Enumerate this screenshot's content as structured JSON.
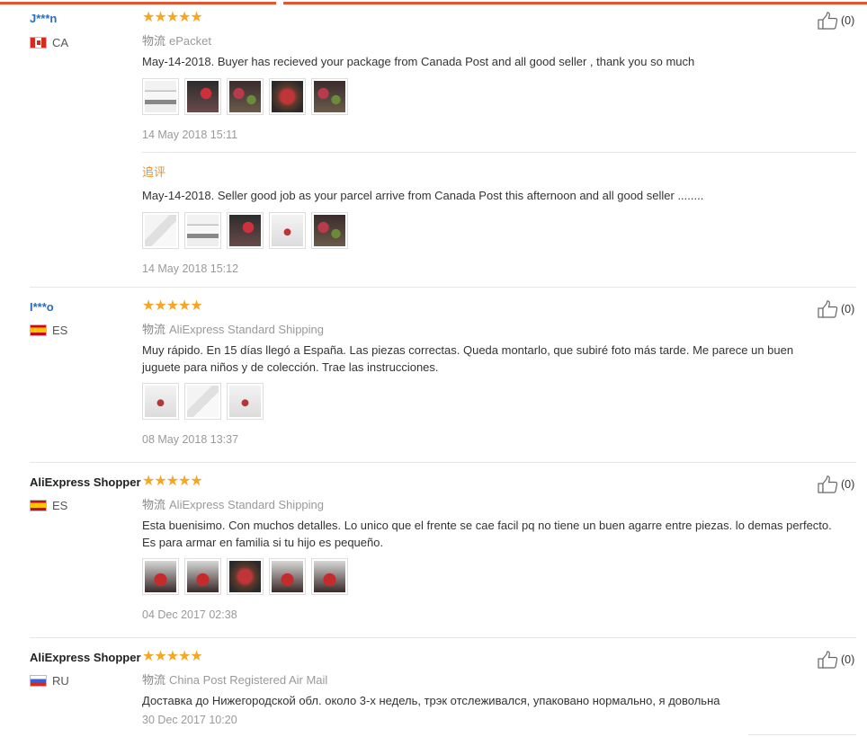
{
  "reviews": [
    {
      "user": "J***n",
      "country": "CA",
      "stars": "★★★★★",
      "shipping_label": "物流",
      "shipping": "ePacket",
      "text": "May-14-2018. Buyer has recieved your package from Canada Post and all good seller , thank you so much",
      "date": "14 May 2018 15:11",
      "likes": "(0)",
      "followup": {
        "label": "追评",
        "text": "May-14-2018. Seller good job as your parcel arrive from Canada Post this afternoon and all good seller ........",
        "date": "14 May 2018 15:12"
      }
    },
    {
      "user": "I***o",
      "country": "ES",
      "stars": "★★★★★",
      "shipping_label": "物流",
      "shipping": "AliExpress Standard Shipping",
      "text": "Muy rápido. En 15 días llegó a España. Las piezas correctas. Queda montarlo, que subiré foto más tarde. Me parece un buen juguete para niños y de colección. Trae las instrucciones.",
      "date": "08 May 2018 13:37",
      "likes": "(0)"
    },
    {
      "user": "AliExpress Shopper",
      "country": "ES",
      "stars": "★★★★★",
      "shipping_label": "物流",
      "shipping": "AliExpress Standard Shipping",
      "text": "Esta buenisimo. Con muchos detalles. Lo unico que el frente se cae facil pq no tiene un buen agarre entre piezas. lo demas perfecto. Es para armar en familia si tu hijo es pequeño.",
      "date": "04 Dec 2017 02:38",
      "likes": "(0)"
    },
    {
      "user": "AliExpress Shopper",
      "country": "RU",
      "stars": "★★★★★",
      "shipping_label": "物流",
      "shipping": "China Post Registered Air Mail",
      "text": "Доставка до Нижегородской обл. около 3-х недель, трэк отслеживался, упаковано нормально, я довольна",
      "date": "30 Dec 2017 10:20",
      "likes": "(0)"
    }
  ],
  "colors": {
    "accent": "#e8532e",
    "star": "#f5a623",
    "followup": "#e8922e",
    "masked_user": "#2a6ebb"
  },
  "icons": {
    "like": "thumbs-up-icon",
    "star": "star-icon"
  }
}
